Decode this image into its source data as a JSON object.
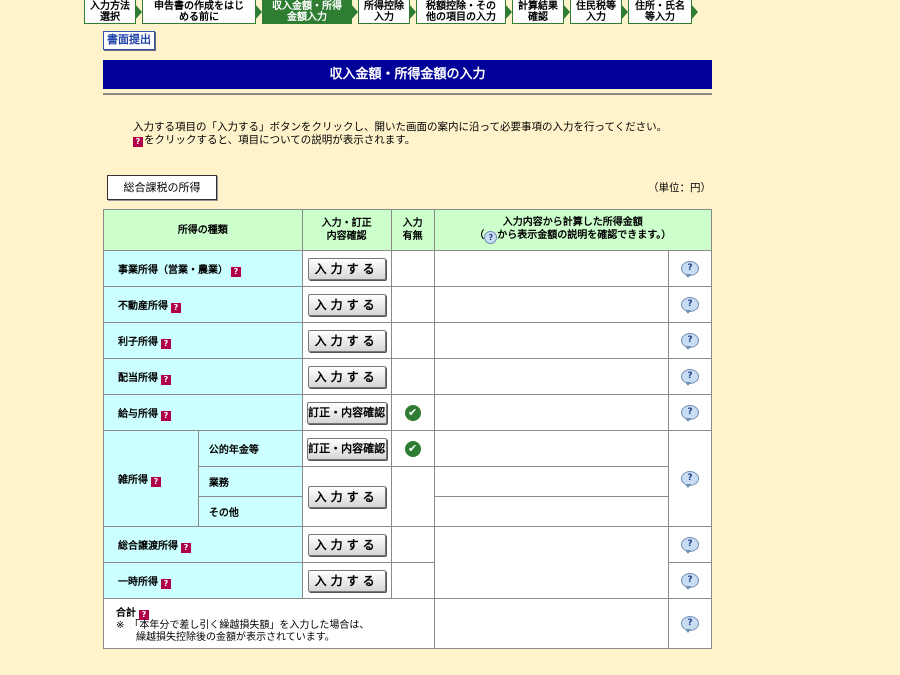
{
  "steps": [
    {
      "label": "入力方法\n選択",
      "active": false,
      "width": 52
    },
    {
      "label": "申告書の作成をはじ\nめる前に",
      "active": false,
      "width": 114
    },
    {
      "label": "収入金額・所得\n金額入力",
      "active": true,
      "width": 90
    },
    {
      "label": "所得控除\n入力",
      "active": false,
      "width": 52
    },
    {
      "label": "税額控除・その\n他の項目の入力",
      "active": false,
      "width": 90
    },
    {
      "label": "計算結果\n確認",
      "active": false,
      "width": 52
    },
    {
      "label": "住民税等\n入力",
      "active": false,
      "width": 52
    },
    {
      "label": "住所・氏名\n等入力",
      "active": false,
      "width": 64
    }
  ],
  "submit_label": "書面提出",
  "banner_title": "収入金額・所得金額の入力",
  "instructions": {
    "line1": "入力する項目の「入力する」ボタンをクリックし、開いた画面の案内に沿って必要事項の入力を行ってください。",
    "help_mark": "?",
    "line2": "をクリックすると、項目についての説明が表示されます。"
  },
  "section_label": "総合課税の所得",
  "unit_label": "（単位：円）",
  "table": {
    "headers": {
      "type": "所得の種類",
      "input_line1": "入力・訂正",
      "input_line2": "内容確認",
      "status_line1": "入力",
      "status_line2": "有無",
      "amount_line1": "入力内容から計算した所得金額",
      "amount_line2_pre": "（",
      "amount_line2_post": "から表示金額の説明を確認できます。）"
    },
    "rows": {
      "business": {
        "label": "事業所得（営業・農業）",
        "button": "入力する"
      },
      "real_estate": {
        "label": "不動産所得",
        "button": "入力する"
      },
      "interest": {
        "label": "利子所得",
        "button": "入力する"
      },
      "dividend": {
        "label": "配当所得",
        "button": "入力する"
      },
      "salary": {
        "label": "給与所得",
        "button": "訂正・内容確認",
        "status": "✔"
      },
      "misc": {
        "label": "雑所得",
        "pension": {
          "label": "公的年金等",
          "button": "訂正・内容確認",
          "status": "✔"
        },
        "business": {
          "label": "業務",
          "button": "入力する"
        },
        "other": {
          "label": "その他"
        }
      },
      "transfer": {
        "label": "総合譲渡所得",
        "button": "入力する"
      },
      "occasional": {
        "label": "一時所得",
        "button": "入力する"
      },
      "total": {
        "label": "合計",
        "note1": "※　「本年分で差し引く繰越損失額」を入力した場合は、",
        "note2": "　　繰越損失控除後の金額が表示されています。"
      }
    },
    "help_mark": "?",
    "info_mark": "?"
  },
  "colors": {
    "background": "#fff3cc",
    "banner": "#000099",
    "header": "#ccffcc",
    "label": "#ccffff",
    "step_active": "#2e7d32"
  }
}
